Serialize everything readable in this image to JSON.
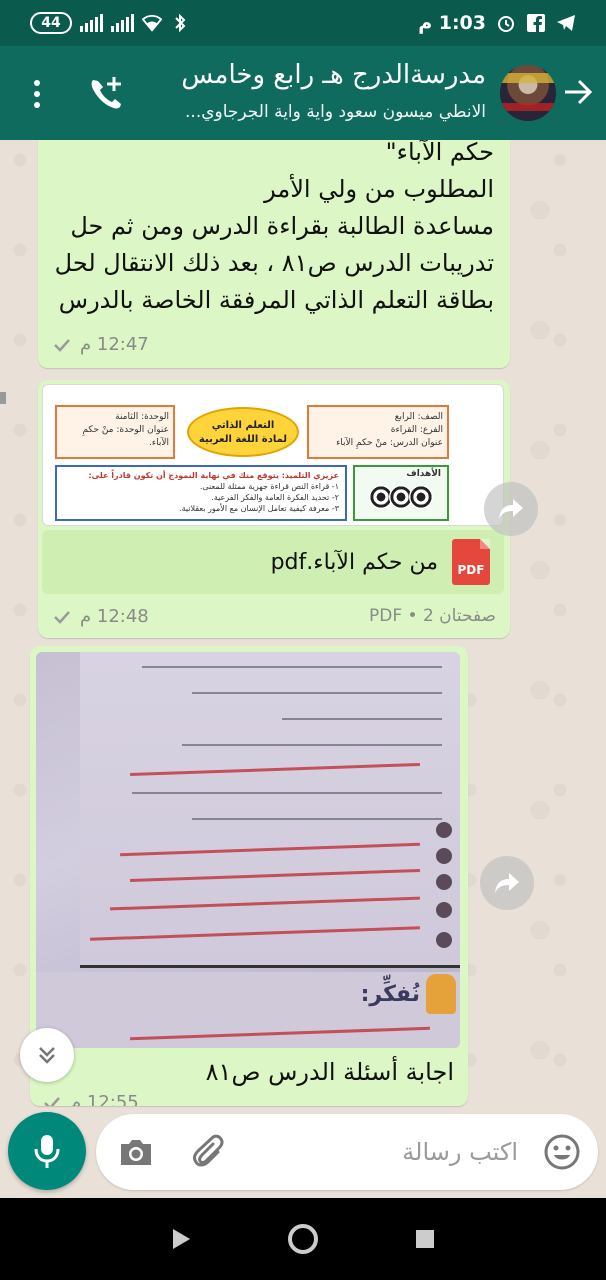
{
  "status_bar": {
    "time": "1:03 م",
    "battery": "44"
  },
  "header": {
    "group_name": "مدرسةالدرج هـ رابع وخامس",
    "members": "الانطي ميسون سعود واية  واية الجرجاوي...",
    "icons": [
      "back-arrow-icon",
      "avatar",
      "add-call-icon",
      "overflow-menu-icon"
    ]
  },
  "messages": [
    {
      "type": "text",
      "lines": [
        "حكم الآباء\"",
        "المطلوب من ولي الأمر",
        "مساعدة الطالبة بقراءة الدرس ومن ثم حل",
        "تدريبات الدرس ص٨١ ، بعد ذلك الانتقال لحل",
        "بطاقة التعلم الذاتي المرفقة الخاصة بالدرس"
      ],
      "time": "12:47 م"
    },
    {
      "type": "document",
      "preview": {
        "right_box": [
          "الصف: الرابع",
          "الفرع: القراءة",
          "عنوان الدرس: منْ حكمِ الآباء"
        ],
        "oval": [
          "التعلم الذاتي",
          "لمادة اللغة العربية"
        ],
        "left_box": [
          "الوحدة: الثامنة",
          "عنوان الوحدة: منْ حكمِ الآباء."
        ],
        "goals_label": "الأهداف",
        "objectives_heading": "عزيزي التلميذ: يتوقع منك في نهاية النموذج أن تكون قادراً على:",
        "objectives": [
          "١- قراءة النص قراءة جهرية ممثلة للمعنى.",
          "٢- تحديد الفكرة العامة والفكر الفرعية.",
          "٣- معرفة كيفية تعامل الإنسان مع الأمور بعقلانية."
        ]
      },
      "file_name": "من حكم الآباء.pdf",
      "file_icon_label": "PDF",
      "pages": "صفحتان 2 • PDF",
      "time": "12:48 م"
    },
    {
      "type": "image",
      "photo_heading": "نُفكِّر:",
      "caption": "اجابة أسئلة الدرس ص٨١",
      "time": "12:55 م"
    }
  ],
  "composer": {
    "placeholder": "اكتب رسالة"
  },
  "colors": {
    "header": "#0e6b5d",
    "status_bar": "#0a5a4e",
    "outgoing_bubble": "#dcf7c5",
    "mic_button": "#00897b",
    "pdf_red": "#e5473c"
  }
}
